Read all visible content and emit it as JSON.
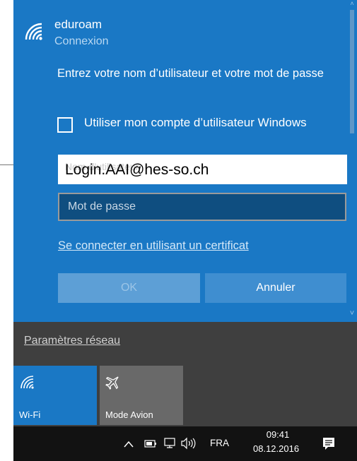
{
  "network": {
    "name": "eduroam",
    "status": "Connexion",
    "instruction": "Entrez votre nom d’utilisateur et votre mot de passe",
    "checkbox_label": "Utiliser mon compte d’utilisateur Windows",
    "checkbox_checked": false,
    "username_placeholder": "Nom d’utilisateur",
    "username_value": "Login.AAI@hes-so.ch",
    "password_placeholder": "Mot de passe",
    "cert_link": "Se connecter en utilisant un certificat",
    "ok_label": "OK",
    "cancel_label": "Annuler"
  },
  "flyout": {
    "settings_link": "Paramètres réseau",
    "tiles": [
      {
        "label": "Wi-Fi",
        "icon": "wifi-icon",
        "active": true
      },
      {
        "label": "Mode Avion",
        "icon": "airplane-icon",
        "active": false
      }
    ]
  },
  "taskbar": {
    "language": "FRA",
    "time": "09:41",
    "date": "08.12.2016"
  },
  "colors": {
    "accent": "#1a78c5",
    "panel_dark": "#3f3f3f",
    "taskbar": "#121212"
  }
}
